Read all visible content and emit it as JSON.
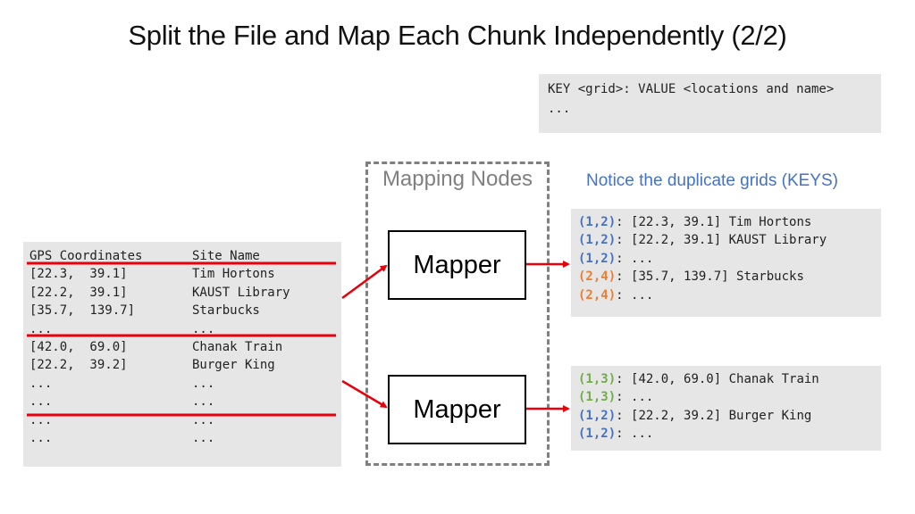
{
  "title": "Split the File and Map Each Chunk Independently (2/2)",
  "legend": {
    "line1": "KEY <grid>: VALUE <locations and name>",
    "line2": "..."
  },
  "colors": {
    "accent_blue": "#4472c4",
    "accent_orange": "#ed7d31",
    "accent_green": "#70ad47",
    "split_line": "#e8000b",
    "box_bg": "#e6e6e6",
    "dashed_border": "#808080"
  },
  "input_table": {
    "headers": [
      "GPS Coordinates",
      "Site Name"
    ],
    "rows": [
      [
        "[22.3,  39.1]",
        "Tim Hortons"
      ],
      [
        "[22.2,  39.1]",
        "KAUST Library"
      ],
      [
        "[35.7,  139.7]",
        "Starbucks"
      ],
      [
        "...",
        "..."
      ],
      [
        "[42.0,  69.0]",
        "Chanak Train"
      ],
      [
        "[22.2,  39.2]",
        "Burger King"
      ],
      [
        "...",
        "..."
      ],
      [
        "...",
        "..."
      ],
      [
        "...",
        "..."
      ],
      [
        "...",
        "..."
      ]
    ]
  },
  "mapping_nodes": {
    "label": "Mapping Nodes",
    "mappers": [
      {
        "label": "Mapper"
      },
      {
        "label": "Mapper"
      }
    ]
  },
  "notice": "Notice the duplicate grids (KEYS)",
  "outputs": [
    {
      "rows": [
        {
          "key": "(1,2)",
          "color": "blue",
          "value": ": [22.3, 39.1] Tim Hortons"
        },
        {
          "key": "(1,2)",
          "color": "blue",
          "value": ": [22.2, 39.1] KAUST Library"
        },
        {
          "key": "(1,2)",
          "color": "blue",
          "value": ": ..."
        },
        {
          "key": "(2,4)",
          "color": "orange",
          "value": ": [35.7, 139.7] Starbucks"
        },
        {
          "key": "(2,4)",
          "color": "orange",
          "value": ": ..."
        }
      ]
    },
    {
      "rows": [
        {
          "key": "(1,3)",
          "color": "green",
          "value": ": [42.0, 69.0] Chanak Train"
        },
        {
          "key": "(1,3)",
          "color": "green",
          "value": ": ..."
        },
        {
          "key": "(1,2)",
          "color": "blue",
          "value": ": [22.2, 39.2] Burger King"
        },
        {
          "key": "(1,2)",
          "color": "blue",
          "value": ": ..."
        }
      ]
    }
  ]
}
